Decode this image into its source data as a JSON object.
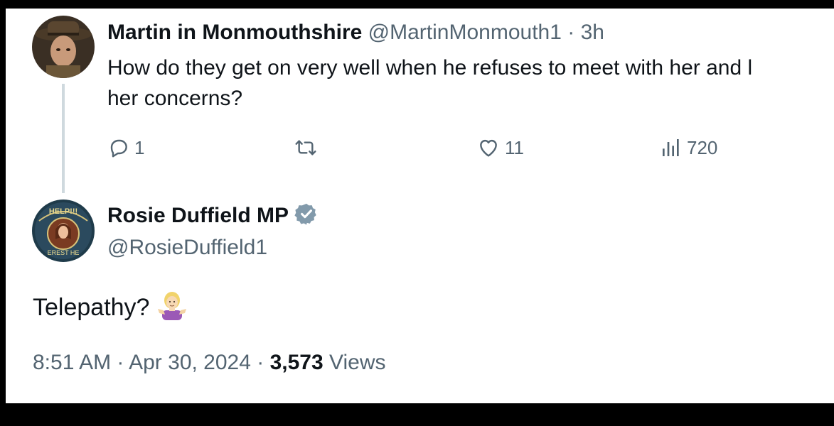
{
  "reply": {
    "author_name": "Martin in Monmouthshire",
    "handle": "@MartinMonmouth1",
    "separator": "·",
    "time": "3h",
    "text_line1": "How do they get on very well when he refuses to meet with her and l",
    "text_line2": "her concerns?",
    "actions": {
      "reply_count": "1",
      "retweet_count": "",
      "like_count": "11",
      "views_count": "720"
    }
  },
  "tweet": {
    "author_name": "Rosie Duffield MP",
    "verified": true,
    "handle": "@RosieDuffield1",
    "text": "Telepathy?",
    "emoji": "woman-shrugging",
    "avatar_text_top": "HELP!!!",
    "avatar_text_bottom": "EREST HE",
    "time": "8:51 AM",
    "date": "Apr 30, 2024",
    "separator": "·",
    "views_count": "3,573",
    "views_label": "Views"
  },
  "colors": {
    "text_primary": "#0f1419",
    "text_secondary": "#536471",
    "thread_line": "#cfd9de",
    "verified_badge": "#829aab",
    "background": "#ffffff"
  }
}
